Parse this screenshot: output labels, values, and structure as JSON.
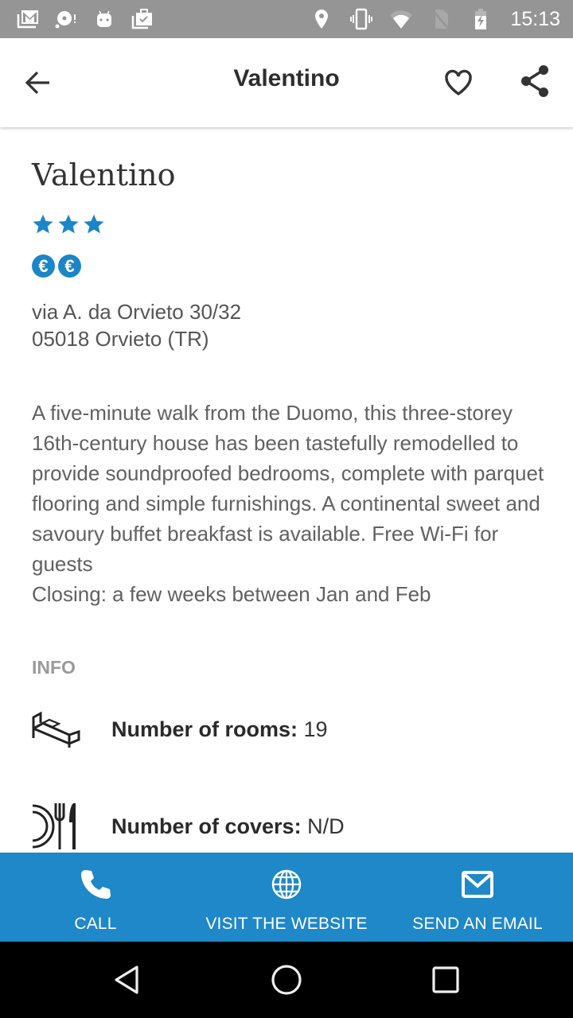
{
  "status_bar": {
    "time": "15:13",
    "left_icons": [
      "gmail-icon",
      "sync-alert-icon",
      "android-icon",
      "work-briefcase-icon"
    ],
    "right_icons": [
      "location-icon",
      "vibrate-icon",
      "wifi-icon",
      "no-sim-icon",
      "battery-charging-icon"
    ]
  },
  "app_bar": {
    "title": "Valentino",
    "back_icon": "arrow-left-icon",
    "favorite_icon": "heart-outline-icon",
    "share_icon": "share-icon"
  },
  "venue": {
    "name": "Valentino",
    "stars": 3,
    "price_level": 2,
    "price_symbol": "€",
    "address_line1": "via A. da Orvieto 30/32",
    "address_line2": "05018 Orvieto (TR)",
    "description": "A five-minute walk from the Duomo, this three-storey 16th-century house has been tastefully remodelled to provide soundproofed bedrooms, complete with parquet flooring and simple furnishings. A continental sweet and savoury buffet breakfast is available. Free Wi-Fi for guests",
    "closing": "Closing: a few weeks between Jan and Feb"
  },
  "info": {
    "section_label": "INFO",
    "rows": [
      {
        "icon": "bed-icon",
        "label": "Number of rooms:",
        "value": "19"
      },
      {
        "icon": "plate-cutlery-icon",
        "label": "Number of covers:",
        "value": "N/D"
      }
    ]
  },
  "actions": [
    {
      "icon": "phone-icon",
      "label": "CALL"
    },
    {
      "icon": "globe-icon",
      "label": "VISIT THE WEBSITE"
    },
    {
      "icon": "mail-icon",
      "label": "SEND AN EMAIL"
    }
  ],
  "colors": {
    "accent": "#1e88c8",
    "status_bar": "#959595",
    "nav_bar": "#000000"
  }
}
